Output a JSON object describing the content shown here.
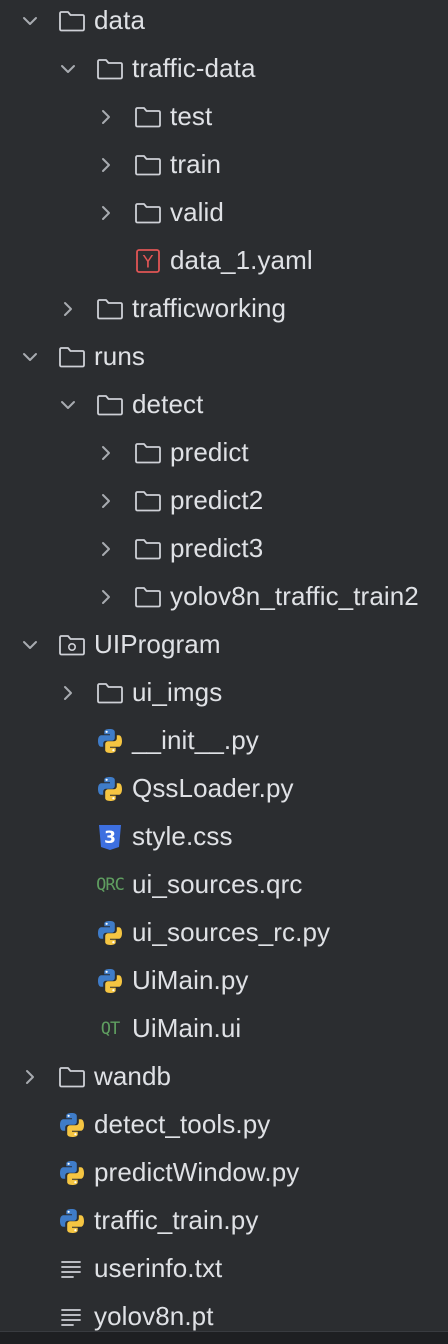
{
  "tree": {
    "items": [
      {
        "label": "data",
        "depth": 0,
        "kind": "folder",
        "expanded": true,
        "icon": "folder-icon"
      },
      {
        "label": "traffic-data",
        "depth": 1,
        "kind": "folder",
        "expanded": true,
        "icon": "folder-icon"
      },
      {
        "label": "test",
        "depth": 2,
        "kind": "folder",
        "expanded": false,
        "icon": "folder-icon"
      },
      {
        "label": "train",
        "depth": 2,
        "kind": "folder",
        "expanded": false,
        "icon": "folder-icon"
      },
      {
        "label": "valid",
        "depth": 2,
        "kind": "folder",
        "expanded": false,
        "icon": "folder-icon"
      },
      {
        "label": "data_1.yaml",
        "depth": 2,
        "kind": "yaml",
        "icon": "yaml-file-icon",
        "icon_text": "Y"
      },
      {
        "label": "trafficworking",
        "depth": 1,
        "kind": "folder",
        "expanded": false,
        "icon": "folder-icon"
      },
      {
        "label": "runs",
        "depth": 0,
        "kind": "folder",
        "expanded": true,
        "icon": "folder-icon"
      },
      {
        "label": "detect",
        "depth": 1,
        "kind": "folder",
        "expanded": true,
        "icon": "folder-icon"
      },
      {
        "label": "predict",
        "depth": 2,
        "kind": "folder",
        "expanded": false,
        "icon": "folder-icon"
      },
      {
        "label": "predict2",
        "depth": 2,
        "kind": "folder",
        "expanded": false,
        "icon": "folder-icon"
      },
      {
        "label": "predict3",
        "depth": 2,
        "kind": "folder",
        "expanded": false,
        "icon": "folder-icon"
      },
      {
        "label": "yolov8n_traffic_train2",
        "depth": 2,
        "kind": "folder",
        "expanded": false,
        "icon": "folder-icon"
      },
      {
        "label": "UIProgram",
        "depth": 0,
        "kind": "package",
        "expanded": true,
        "icon": "package-folder-icon"
      },
      {
        "label": "ui_imgs",
        "depth": 1,
        "kind": "folder",
        "expanded": false,
        "icon": "folder-icon"
      },
      {
        "label": "__init__.py",
        "depth": 1,
        "kind": "python",
        "icon": "python-file-icon"
      },
      {
        "label": "QssLoader.py",
        "depth": 1,
        "kind": "python",
        "icon": "python-file-icon"
      },
      {
        "label": "style.css",
        "depth": 1,
        "kind": "css",
        "icon": "css-file-icon",
        "icon_text": "3"
      },
      {
        "label": "ui_sources.qrc",
        "depth": 1,
        "kind": "qrc",
        "icon": "qrc-file-icon",
        "icon_text": "QRC"
      },
      {
        "label": "ui_sources_rc.py",
        "depth": 1,
        "kind": "python",
        "icon": "python-file-icon"
      },
      {
        "label": "UiMain.py",
        "depth": 1,
        "kind": "python",
        "icon": "python-file-icon"
      },
      {
        "label": "UiMain.ui",
        "depth": 1,
        "kind": "qt",
        "icon": "qt-ui-file-icon",
        "icon_text": "QT"
      },
      {
        "label": "wandb",
        "depth": 0,
        "kind": "folder",
        "expanded": false,
        "icon": "folder-icon"
      },
      {
        "label": "detect_tools.py",
        "depth": 0,
        "kind": "python",
        "icon": "python-file-icon"
      },
      {
        "label": "predictWindow.py",
        "depth": 0,
        "kind": "python",
        "icon": "python-file-icon"
      },
      {
        "label": "traffic_train.py",
        "depth": 0,
        "kind": "python",
        "icon": "python-file-icon"
      },
      {
        "label": "userinfo.txt",
        "depth": 0,
        "kind": "text",
        "icon": "text-file-icon"
      },
      {
        "label": "yolov8n.pt",
        "depth": 0,
        "kind": "text",
        "icon": "text-file-icon"
      }
    ]
  },
  "colors": {
    "background": "#2b2d30",
    "text": "#dfe1e5",
    "icon_stroke": "#ced0d6",
    "chevron": "#a8abb0",
    "yaml_red": "#e05555",
    "css_blue": "#3d6fe0",
    "python_blue": "#3f7cc8",
    "python_yellow": "#f5c542",
    "qt_green": "#5f9e60"
  }
}
